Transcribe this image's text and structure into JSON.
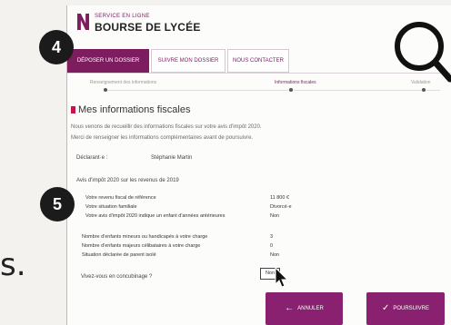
{
  "letter": "s.",
  "header": {
    "service_label": "SERVICE EN LIGNE",
    "title": "BOURSE DE LYCÉE"
  },
  "tabs": [
    {
      "label": "DÉPOSER UN DOSSIER",
      "active": true
    },
    {
      "label": "SUIVRE MON DOSSIER",
      "active": false
    },
    {
      "label": "NOUS CONTACTER",
      "active": false
    }
  ],
  "steps": [
    {
      "label": "Renseignement des informations",
      "current": false
    },
    {
      "label": "Informations fiscales",
      "current": true
    },
    {
      "label": "Validation",
      "current": false
    }
  ],
  "section": {
    "title": "Mes informations fiscales",
    "intro_line1": "Nous venons de recueillir des informations fiscales sur votre avis d'impôt 2020.",
    "intro_line2": "Merci de renseigner les informations complémentaires avant de poursuivre."
  },
  "declarant": {
    "label": "Déclarant·e :",
    "name": "Stéphanie Martin"
  },
  "avis": "Avis d'impôt 2020 sur les revenus de 2019",
  "fiscal_rows": [
    {
      "label": "Votre revenu fiscal de référence",
      "value": "11 800 €"
    },
    {
      "label": "Votre situation familiale",
      "value": "Divorcé·e"
    },
    {
      "label": "Votre avis d'impôt 2020 indique un enfant d'années antérieures",
      "value": "Non"
    }
  ],
  "family_rows": [
    {
      "label": "Nombre d'enfants mineurs ou handicapés à votre charge",
      "value": "3"
    },
    {
      "label": "Nombre d'enfants majeurs célibataires à votre charge",
      "value": "0"
    },
    {
      "label": "Situation déclarée de parent isolé",
      "value": "Non"
    }
  ],
  "question": {
    "label": "Vivez-vous en concubinage ?",
    "selected": "Non"
  },
  "buttons": {
    "cancel": "ANNULER",
    "continue": "POURSUIVRE"
  },
  "badges": {
    "four": "4",
    "five": "5"
  },
  "icons": {
    "cursor": "pointer-cursor-icon",
    "magnifier": "magnifier-icon",
    "check": "check-icon",
    "back": "back-arrow-icon"
  },
  "colors": {
    "brand": "#7d1c5e",
    "button": "#8a2170",
    "accent_bar": "#c0174f"
  }
}
